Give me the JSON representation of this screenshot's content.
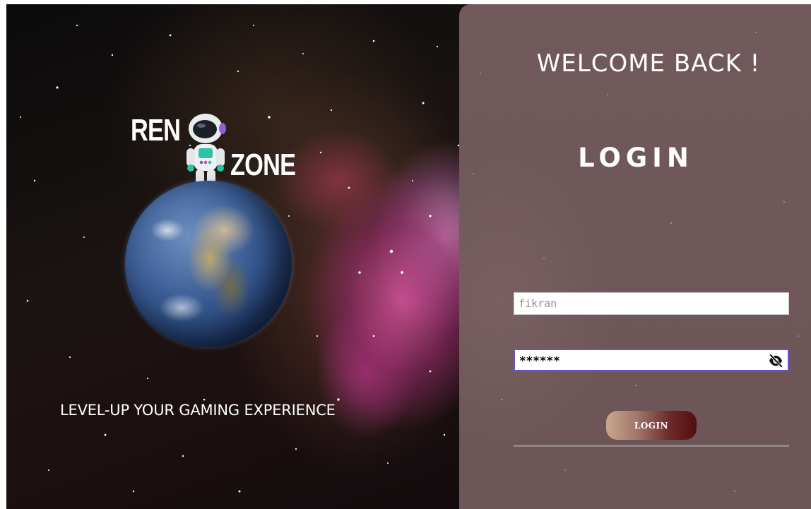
{
  "hero": {
    "logo": {
      "word_top": "REN",
      "word_bottom": "ZONE"
    },
    "tagline": "LEVEL-UP YOUR GAMING EXPERIENCE"
  },
  "login_panel": {
    "welcome": "WELCOME BACK !",
    "title": "LOGIN",
    "username": {
      "value": "fikran"
    },
    "password": {
      "value": "******",
      "toggle_icon": "eye-off-icon"
    },
    "submit_label": "LOGIN"
  },
  "colors": {
    "panel_bg": "#6f5759",
    "focus_border": "#6f52c9",
    "button_start": "#c8a88e",
    "button_end": "#520e10"
  }
}
